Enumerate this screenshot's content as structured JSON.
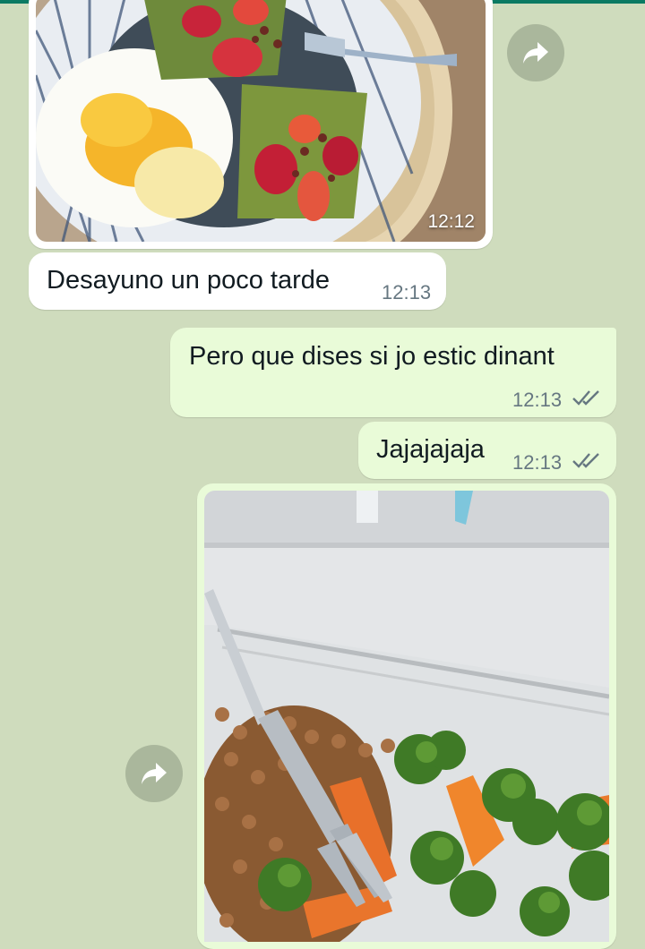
{
  "chat": {
    "messages": [
      {
        "kind": "image",
        "direction": "incoming",
        "time": "12:12",
        "image_content": "breakfast-plate-fried-egg-avocado-toast-strawberries",
        "action_icon": "forward-icon"
      },
      {
        "kind": "text",
        "direction": "incoming",
        "text": "Desayuno un poco tarde",
        "time": "12:13"
      },
      {
        "kind": "text",
        "direction": "outgoing",
        "text": "Pero que dises si jo estic dinant",
        "time": "12:13",
        "status_icon": "double-check-icon"
      },
      {
        "kind": "text",
        "direction": "outgoing",
        "text": "Jajajajaja",
        "time": "12:13",
        "status_icon": "double-check-icon"
      },
      {
        "kind": "image",
        "direction": "outgoing",
        "image_content": "lentils-carrots-broccoli-in-glass-container-with-fork",
        "action_icon": "forward-icon"
      }
    ]
  },
  "colors": {
    "chat_background": "#cfdcbd",
    "incoming_bubble": "#ffffff",
    "outgoing_bubble": "#e9fbd8",
    "top_bar": "#0b7a63",
    "timestamp": "#667781"
  }
}
